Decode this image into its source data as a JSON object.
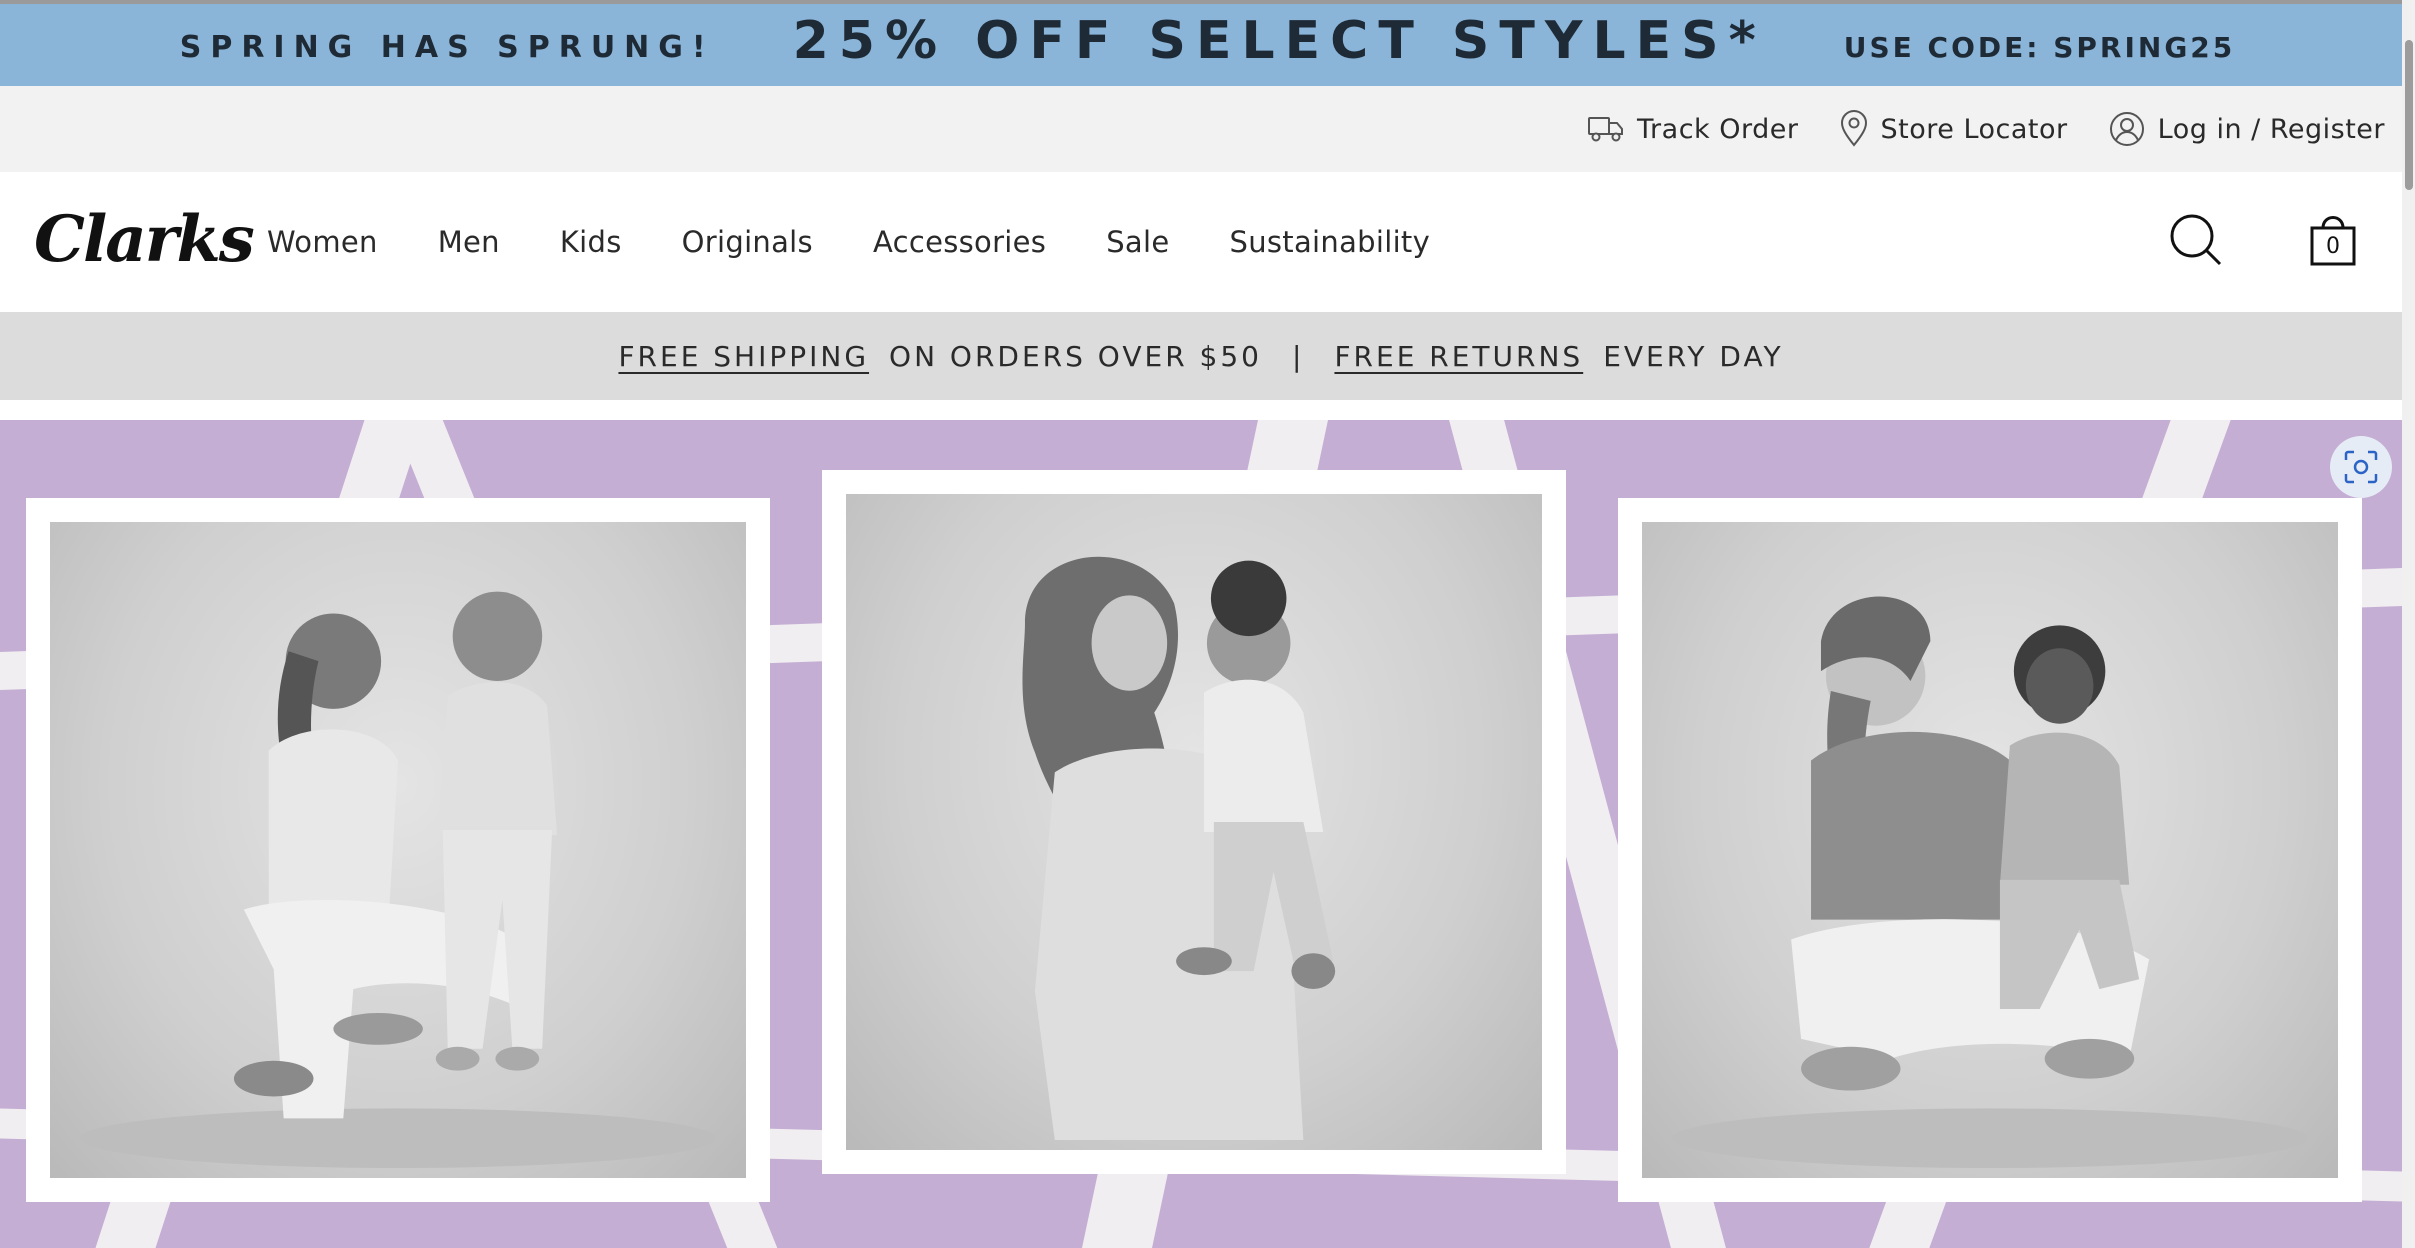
{
  "promo": {
    "lead": "SPRING HAS SPRUNG!",
    "headline": "25% OFF SELECT STYLES*",
    "code": "USE CODE: SPRING25",
    "background": "#8ab4d8"
  },
  "utility": {
    "track_order": {
      "label": "Track Order",
      "icon": "truck-icon"
    },
    "store_locator": {
      "label": "Store Locator",
      "icon": "map-pin-icon"
    },
    "account": {
      "label": "Log in / Register",
      "icon": "user-circle-icon"
    }
  },
  "header": {
    "logo": "Clarks",
    "nav": [
      "Women",
      "Men",
      "Kids",
      "Originals",
      "Accessories",
      "Sale",
      "Sustainability"
    ],
    "search_icon": "search-icon",
    "bag_icon": "shopping-bag-icon",
    "bag_count": "0"
  },
  "shipping": {
    "free_shipping": "FREE SHIPPING",
    "orders_text": "ON ORDERS OVER $50",
    "separator": "|",
    "free_returns": "FREE RETURNS",
    "every_day": "EVERY DAY",
    "background": "#dcdcdc"
  },
  "hero": {
    "background": "#c5aed4",
    "images": [
      {
        "alt": "woman-sitting-with-toddler-photo"
      },
      {
        "alt": "woman-in-headscarf-holding-baby-photo"
      },
      {
        "alt": "woman-sitting-cross-legged-with-toddler-photo"
      }
    ],
    "scan_icon": "visual-search-icon"
  }
}
